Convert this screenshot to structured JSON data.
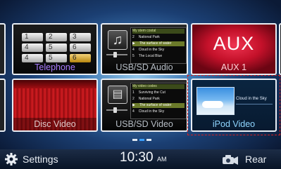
{
  "tiles": {
    "telephone": {
      "label": "Telephone",
      "keys": [
        "1",
        "2",
        "3",
        "4",
        "5",
        "6",
        "4",
        "5",
        "6"
      ]
    },
    "usb_audio": {
      "label": "USB/SD Audio",
      "list": [
        "My stem costal",
        "National Park",
        "The surface of water",
        "Cloud in the Sky",
        "The Local Blue"
      ]
    },
    "aux": {
      "big_label": "AUX",
      "label": "AUX 1"
    },
    "disc_video": {
      "label": "Disc Video"
    },
    "usb_video": {
      "label": "USB/SD Video",
      "list": [
        "My video codes",
        "Surviving the Cut",
        "National Park",
        "The surface of water",
        "Cloud in the Sky"
      ],
      "numbers": [
        "1",
        "2",
        "3",
        "4"
      ]
    },
    "ipod_video": {
      "label": "iPod Video",
      "screen_title": "Cloud in the Sky"
    }
  },
  "status_bar": {
    "settings_label": "Settings",
    "time": "10:30",
    "ampm": "AM",
    "rear_label": "Rear"
  },
  "colors": {
    "telephone_label": "#a87bff",
    "tile_label": "#b6bdc5",
    "aux_bg": "#d3132d",
    "selection": "#d91f1f"
  },
  "page_indicator": {
    "pages": 3,
    "current": 2
  }
}
